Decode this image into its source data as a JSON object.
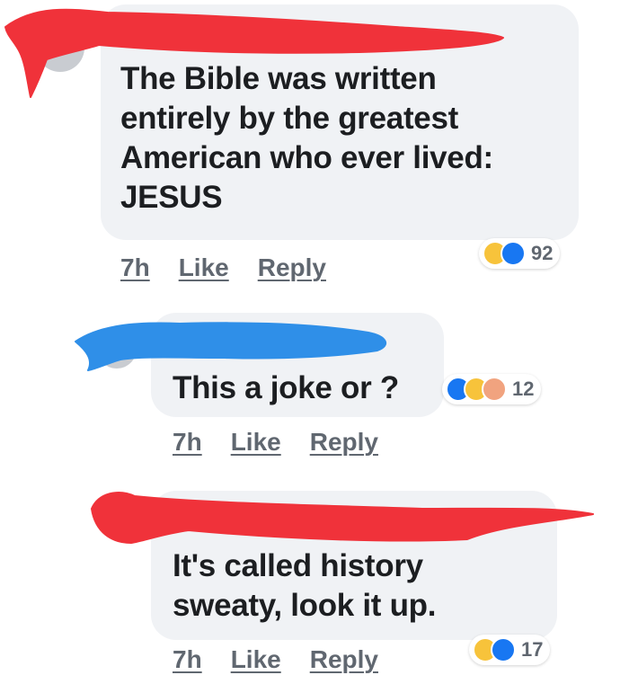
{
  "comments": [
    {
      "lines": [
        "The Bible was written",
        "entirely by the greatest",
        "American who ever lived:",
        "JESUS"
      ],
      "time": "7h",
      "like_label": "Like",
      "reply_label": "Reply",
      "reactions": [
        "haha-icon",
        "like-icon"
      ],
      "reaction_count": "92"
    },
    {
      "lines": [
        "This a joke or ?"
      ],
      "time": "7h",
      "like_label": "Like",
      "reply_label": "Reply",
      "reactions": [
        "like-icon",
        "haha-icon",
        "angry-icon"
      ],
      "reaction_count": "12"
    },
    {
      "lines": [
        "It's called history",
        "sweaty, look it up."
      ],
      "time": "7h",
      "like_label": "Like",
      "reply_label": "Reply",
      "reactions": [
        "haha-icon",
        "like-icon"
      ],
      "reaction_count": "17"
    }
  ],
  "colors": {
    "bubble": "#f0f2f5",
    "meta_text": "#606770",
    "comment_text": "#1c1e21",
    "red_redaction": "#f0323a",
    "blue_redaction": "#2f8fe8",
    "like_blue": "#1877f2",
    "haha_yellow": "#f7c33b"
  }
}
